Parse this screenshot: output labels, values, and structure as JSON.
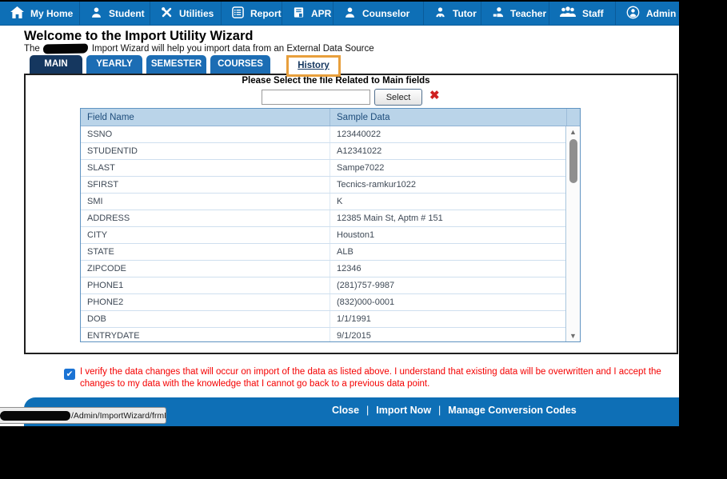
{
  "nav": {
    "items": [
      {
        "label": "My Home",
        "icon": "home-icon"
      },
      {
        "label": "Student",
        "icon": "student-icon"
      },
      {
        "label": "Utilities",
        "icon": "utilities-icon"
      },
      {
        "label": "Reports",
        "icon": "reports-icon"
      },
      {
        "label": "APR",
        "icon": "apr-icon"
      },
      {
        "label": "Counselor",
        "icon": "counselor-icon"
      },
      {
        "label": "Tutor",
        "icon": "tutor-icon"
      },
      {
        "label": "Teacher",
        "icon": "teacher-icon"
      },
      {
        "label": "Staff",
        "icon": "staff-icon"
      },
      {
        "label": "Admin",
        "icon": "admin-icon"
      }
    ]
  },
  "header": {
    "title": "Welcome to the Import Utility Wizard",
    "subtitle_prefix": "The",
    "subtitle_suffix": "Import Wizard will help you import data from an External Data Source"
  },
  "tabs": [
    {
      "label": "MAIN",
      "style": "dark"
    },
    {
      "label": "YEARLY",
      "style": "blue"
    },
    {
      "label": "SEMESTER",
      "style": "blue"
    },
    {
      "label": "COURSES",
      "style": "blue"
    },
    {
      "label": "History",
      "style": "highlighted"
    }
  ],
  "file_select": {
    "prompt": "Please Select the file Related to Main fields",
    "input_value": "",
    "button_label": "Select"
  },
  "table": {
    "columns": [
      "Field Name",
      "Sample Data"
    ],
    "rows": [
      {
        "field": "SSNO",
        "sample": "123440022"
      },
      {
        "field": "STUDENTID",
        "sample": "A12341022"
      },
      {
        "field": "SLAST",
        "sample": "Sampe7022"
      },
      {
        "field": "SFIRST",
        "sample": "Tecnics-ramkur1022"
      },
      {
        "field": "SMI",
        "sample": "K"
      },
      {
        "field": "ADDRESS",
        "sample": "12385 Main St, Aptm # 151"
      },
      {
        "field": "CITY",
        "sample": "Houston1"
      },
      {
        "field": "STATE",
        "sample": "ALB"
      },
      {
        "field": "ZIPCODE",
        "sample": "12346"
      },
      {
        "field": "PHONE1",
        "sample": "(281)757-9987"
      },
      {
        "field": "PHONE2",
        "sample": "(832)000-0001"
      },
      {
        "field": "DOB",
        "sample": "1/1/1991"
      },
      {
        "field": "ENTRYDATE",
        "sample": "9/1/2015"
      }
    ]
  },
  "verify": {
    "checked": true,
    "text": "I verify the data changes that will occur on import of the data as listed above. I understand that existing data will be overwritten and I accept the changes to my data with the knowledge that I cannot go back to a previous data point."
  },
  "footer": {
    "links": [
      "Close",
      "Import Now",
      "Manage Conversion Codes"
    ],
    "separator": "|"
  },
  "statusbar": {
    "url_path": "/Admin/ImportWizard/frmImportMaping.aspx#"
  },
  "icons": {
    "check": "✔",
    "red_x": "✖",
    "scroll_up": "▲",
    "scroll_down": "▼"
  },
  "colors": {
    "nav_blue": "#0e6fb6",
    "dark_navy_tab": "#15375f",
    "tab_blue": "#1c6db4",
    "highlight_orange": "#e89f3c",
    "table_header_bg": "#bad4e9",
    "table_header_text": "#1e4d7b",
    "alert_red": "#f40000",
    "footer_blue": "#0e6fb6"
  }
}
